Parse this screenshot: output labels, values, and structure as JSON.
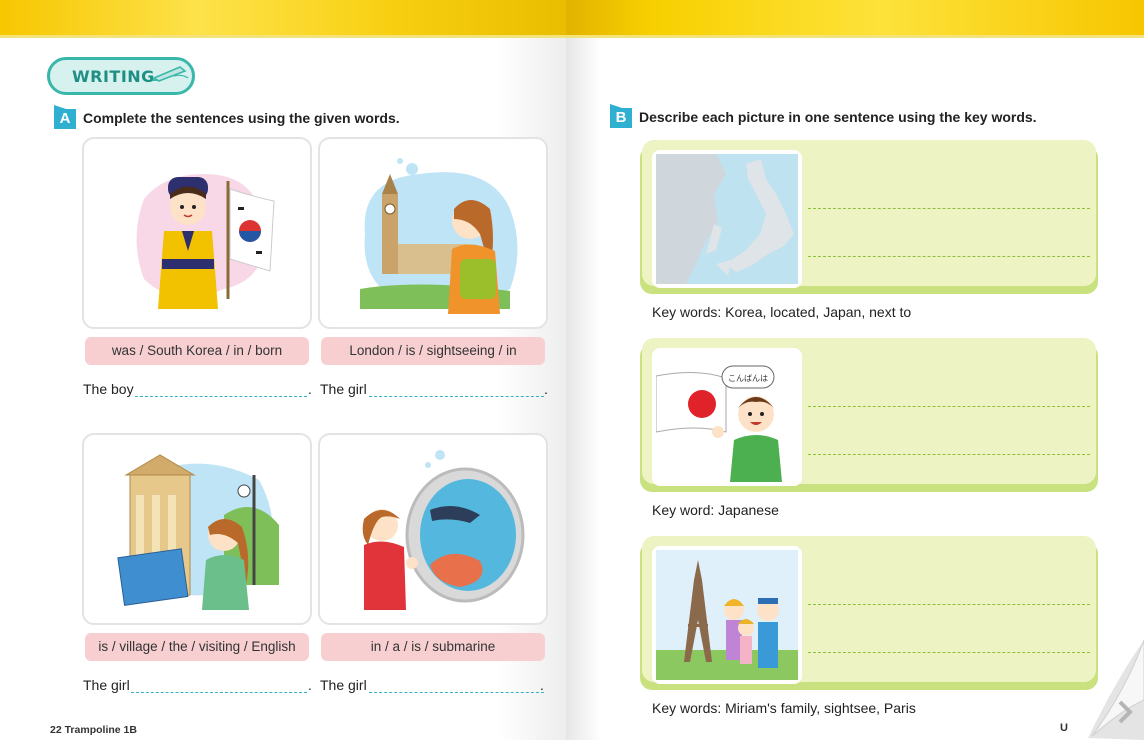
{
  "left_page": {
    "badge": "WRITING",
    "section_a": {
      "tag": "A",
      "instruction": "Complete the sentences using the given words.",
      "items": [
        {
          "words": "was / South Korea / in / born",
          "prompt": "The boy",
          "end": "."
        },
        {
          "words": "London / is / sightseeing / in",
          "prompt": "The girl",
          "end": "."
        },
        {
          "words": "is / village / the / visiting / English",
          "prompt": "The girl",
          "end": "."
        },
        {
          "words": "in / a / is / submarine",
          "prompt": "The girl",
          "end": "."
        }
      ]
    },
    "footer": "22 Trampoline 1B"
  },
  "right_page": {
    "section_b": {
      "tag": "B",
      "instruction": "Describe each picture in one sentence using the key words.",
      "items": [
        {
          "keywords": "Key words: Korea, located, Japan, next to"
        },
        {
          "keywords": "Key word: Japanese",
          "speech": "こんばんは"
        },
        {
          "keywords": "Key words: Miriam's family, sightsee, Paris"
        }
      ]
    },
    "footer": "U"
  },
  "colors": {
    "band": "#f9d100",
    "pill": "#39b7aa",
    "tag": "#2fb0d1",
    "word_box": "#f7cfd1",
    "green_card": "#eef3c4",
    "blank": "#33b2c4"
  }
}
